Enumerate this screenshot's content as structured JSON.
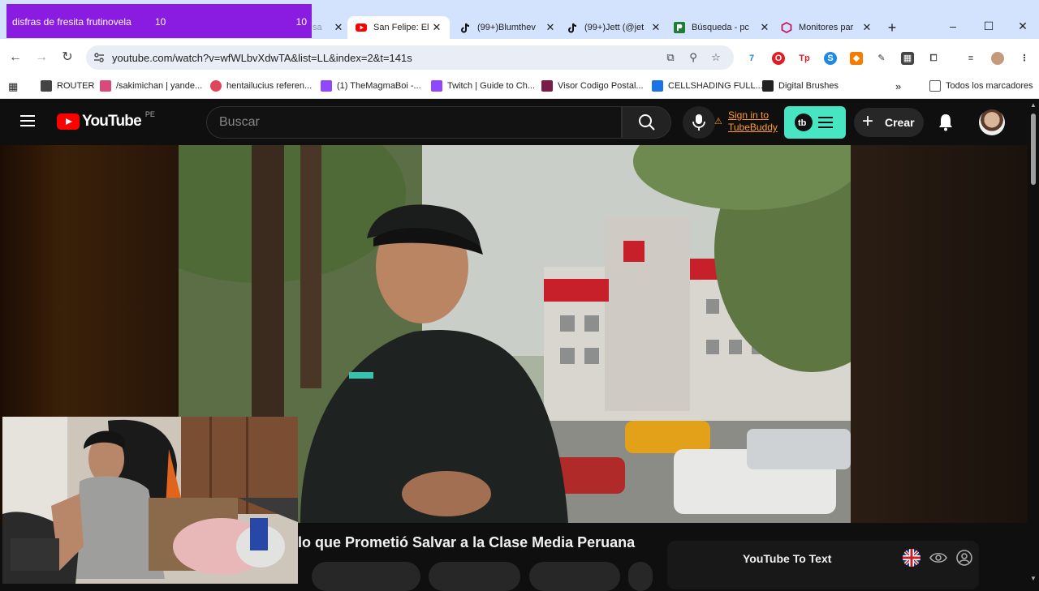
{
  "overlay": {
    "title": "disfras de fresita frutinovela",
    "count_a": "10",
    "count_b": "10"
  },
  "tabs": [
    {
      "label": "San Felipe: El E",
      "icon": "youtube-icon",
      "active": true
    },
    {
      "label": "(99+)Blumthev",
      "icon": "tiktok-icon",
      "active": false
    },
    {
      "label": "(99+)Jett (@jet",
      "icon": "tiktok-icon",
      "active": false
    },
    {
      "label": "Búsqueda - pc",
      "icon": "picarto-icon",
      "active": false
    },
    {
      "label": "Monitores par",
      "icon": "hexagon-icon",
      "active": false
    }
  ],
  "address_bar": {
    "url": "youtube.com/watch?v=wfWLbvXdwTA&list=LL&index=2&t=141s"
  },
  "bookmarks": [
    {
      "label": "ROUTER",
      "icon": "tools-icon",
      "color": "#444444"
    },
    {
      "label": "/sakimichan | yande...",
      "icon": "anime-icon",
      "color": "#d94a7a"
    },
    {
      "label": "hentailucius referen...",
      "icon": "leaf-icon",
      "color": "#e0455a"
    },
    {
      "label": "(1) TheMagmaBoi -...",
      "icon": "twitch-icon",
      "color": "#9146ff"
    },
    {
      "label": "Twitch | Guide to Ch...",
      "icon": "twitch-icon",
      "color": "#9146ff"
    },
    {
      "label": "Visor Codigo Postal...",
      "icon": "chevron-icon",
      "color": "#7a1c4a"
    },
    {
      "label": "CELLSHADING FULL...",
      "icon": "bookmark-c-icon",
      "color": "#1a73e8"
    },
    {
      "label": "Digital Brushes",
      "icon": "brush-icon",
      "color": "#222222"
    }
  ],
  "bookmarks_all": "Todos los marcadores",
  "youtube": {
    "logo_text": "YouTube",
    "country": "PE",
    "search_placeholder": "Buscar",
    "tubebuddy_line1": "Sign in to",
    "tubebuddy_line2": "TubeBuddy",
    "create_label": "Crear",
    "video_title": "lo que Prometió Salvar a la Clase Media Peruana",
    "side_panel_title": "YouTube To Text"
  },
  "colors": {
    "yt_red": "#ff0000",
    "tubebuddy": "#ff9c2a",
    "tb_button": "#48e5c2",
    "overlay": "#8a1be0",
    "chrome_tab": "#d3e3fd"
  }
}
